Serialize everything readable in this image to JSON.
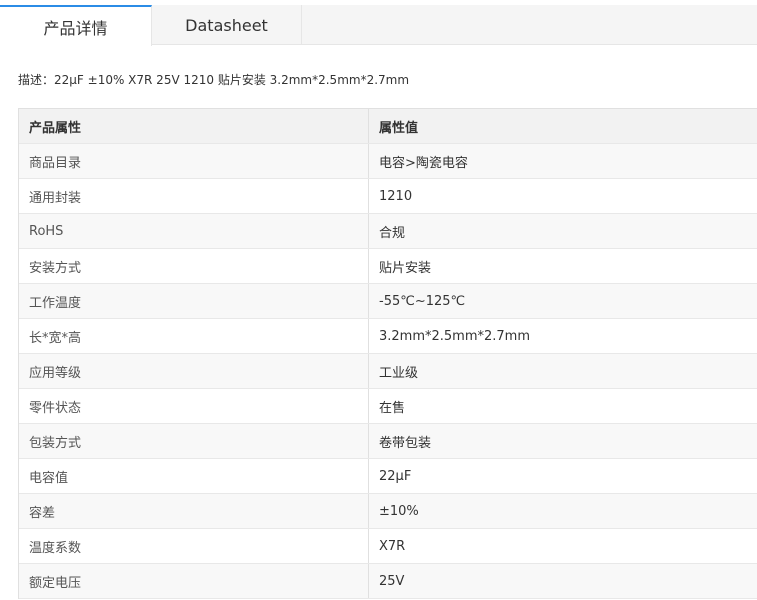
{
  "tabs": [
    {
      "label": "产品详情",
      "active": true
    },
    {
      "label": "Datasheet",
      "active": false
    }
  ],
  "description": {
    "prefix": "描述：",
    "text": "22μF ±10% X7R 25V 1210 贴片安装 3.2mm*2.5mm*2.7mm"
  },
  "table": {
    "headers": [
      "产品属性",
      "属性值"
    ],
    "rows": [
      [
        "商品目录",
        "电容>陶瓷电容"
      ],
      [
        "通用封装",
        "1210"
      ],
      [
        "RoHS",
        "合规"
      ],
      [
        "安装方式",
        "贴片安装"
      ],
      [
        "工作温度",
        "-55℃~125℃"
      ],
      [
        "长*宽*高",
        "3.2mm*2.5mm*2.7mm"
      ],
      [
        "应用等级",
        "工业级"
      ],
      [
        "零件状态",
        "在售"
      ],
      [
        "包装方式",
        "卷带包装"
      ],
      [
        "电容值",
        "22μF"
      ],
      [
        "容差",
        "±10%"
      ],
      [
        "温度系数",
        "X7R"
      ],
      [
        "额定电压",
        "25V"
      ]
    ]
  }
}
